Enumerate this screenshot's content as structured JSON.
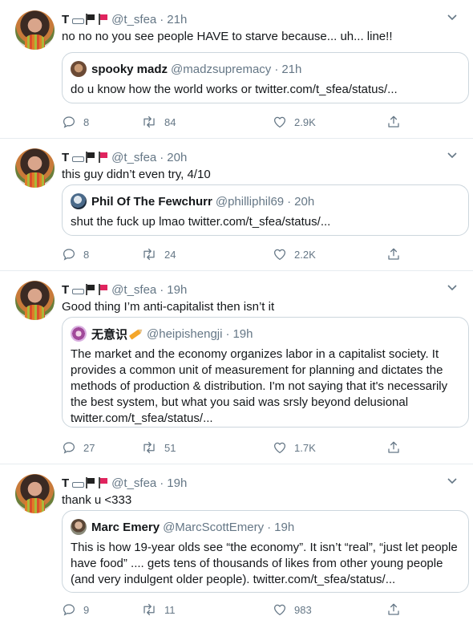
{
  "tweets": [
    {
      "name": "T",
      "handle": "@t_sfea",
      "dot": "·",
      "time": "21h",
      "text": "no no no you see people HAVE to starve because... uh... line!!",
      "quote": {
        "name": "spooky madz",
        "handle": "@madzsupremacy",
        "dot": "·",
        "time": "21h",
        "text": "do u know how the world works or twitter.com/t_sfea/status/..."
      },
      "replies": "8",
      "retweets": "84",
      "likes": "2.9K"
    },
    {
      "name": "T",
      "handle": "@t_sfea",
      "dot": "·",
      "time": "20h",
      "text": "this guy didn’t even try, 4/10",
      "quote": {
        "name": "Phil Of The Fewchurr",
        "handle": "@philliphil69",
        "dot": "·",
        "time": "20h",
        "text": "shut the fuck up lmao twitter.com/t_sfea/status/..."
      },
      "replies": "8",
      "retweets": "24",
      "likes": "2.2K"
    },
    {
      "name": "T",
      "handle": "@t_sfea",
      "dot": "·",
      "time": "19h",
      "text": "Good thing I’m anti-capitalist then isn’t it",
      "quote": {
        "name": "无意识",
        "handle": "@heipishengji",
        "dot": "·",
        "time": "19h",
        "text_lines": [
          "The market and the economy organizes labor in a capitalist society. It",
          "provides a common unit of measurement for planning and dictates the",
          "methods of production & distribution. I'm not saying that it's necessarily",
          "the best system, but what you said was srsly beyond delusional",
          "twitter.com/t_sfea/status/..."
        ]
      },
      "replies": "27",
      "retweets": "51",
      "likes": "1.7K"
    },
    {
      "name": "T",
      "handle": "@t_sfea",
      "dot": "·",
      "time": "19h",
      "text": "thank u <333",
      "quote": {
        "name": "Marc Emery",
        "handle": "@MarcScottEmery",
        "dot": "·",
        "time": "19h",
        "text_lines": [
          "This is how 19-year olds see “the economy”. It isn’t “real”, “just let people",
          "have food” .... gets tens of thousands of likes from other young people",
          "(and very indulgent older people). twitter.com/t_sfea/status/..."
        ]
      },
      "replies": "9",
      "retweets": "11",
      "likes": "983"
    }
  ],
  "icons": {
    "reply": "reply-icon",
    "retweet": "retweet-icon",
    "like": "heart-icon",
    "share": "share-icon",
    "more": "chevron-down-icon"
  },
  "colors": {
    "text": "#14171a",
    "secondary": "#657786",
    "border": "#ccd6dd",
    "divider": "#e6ecf0",
    "flag_red": "#e0245e"
  }
}
